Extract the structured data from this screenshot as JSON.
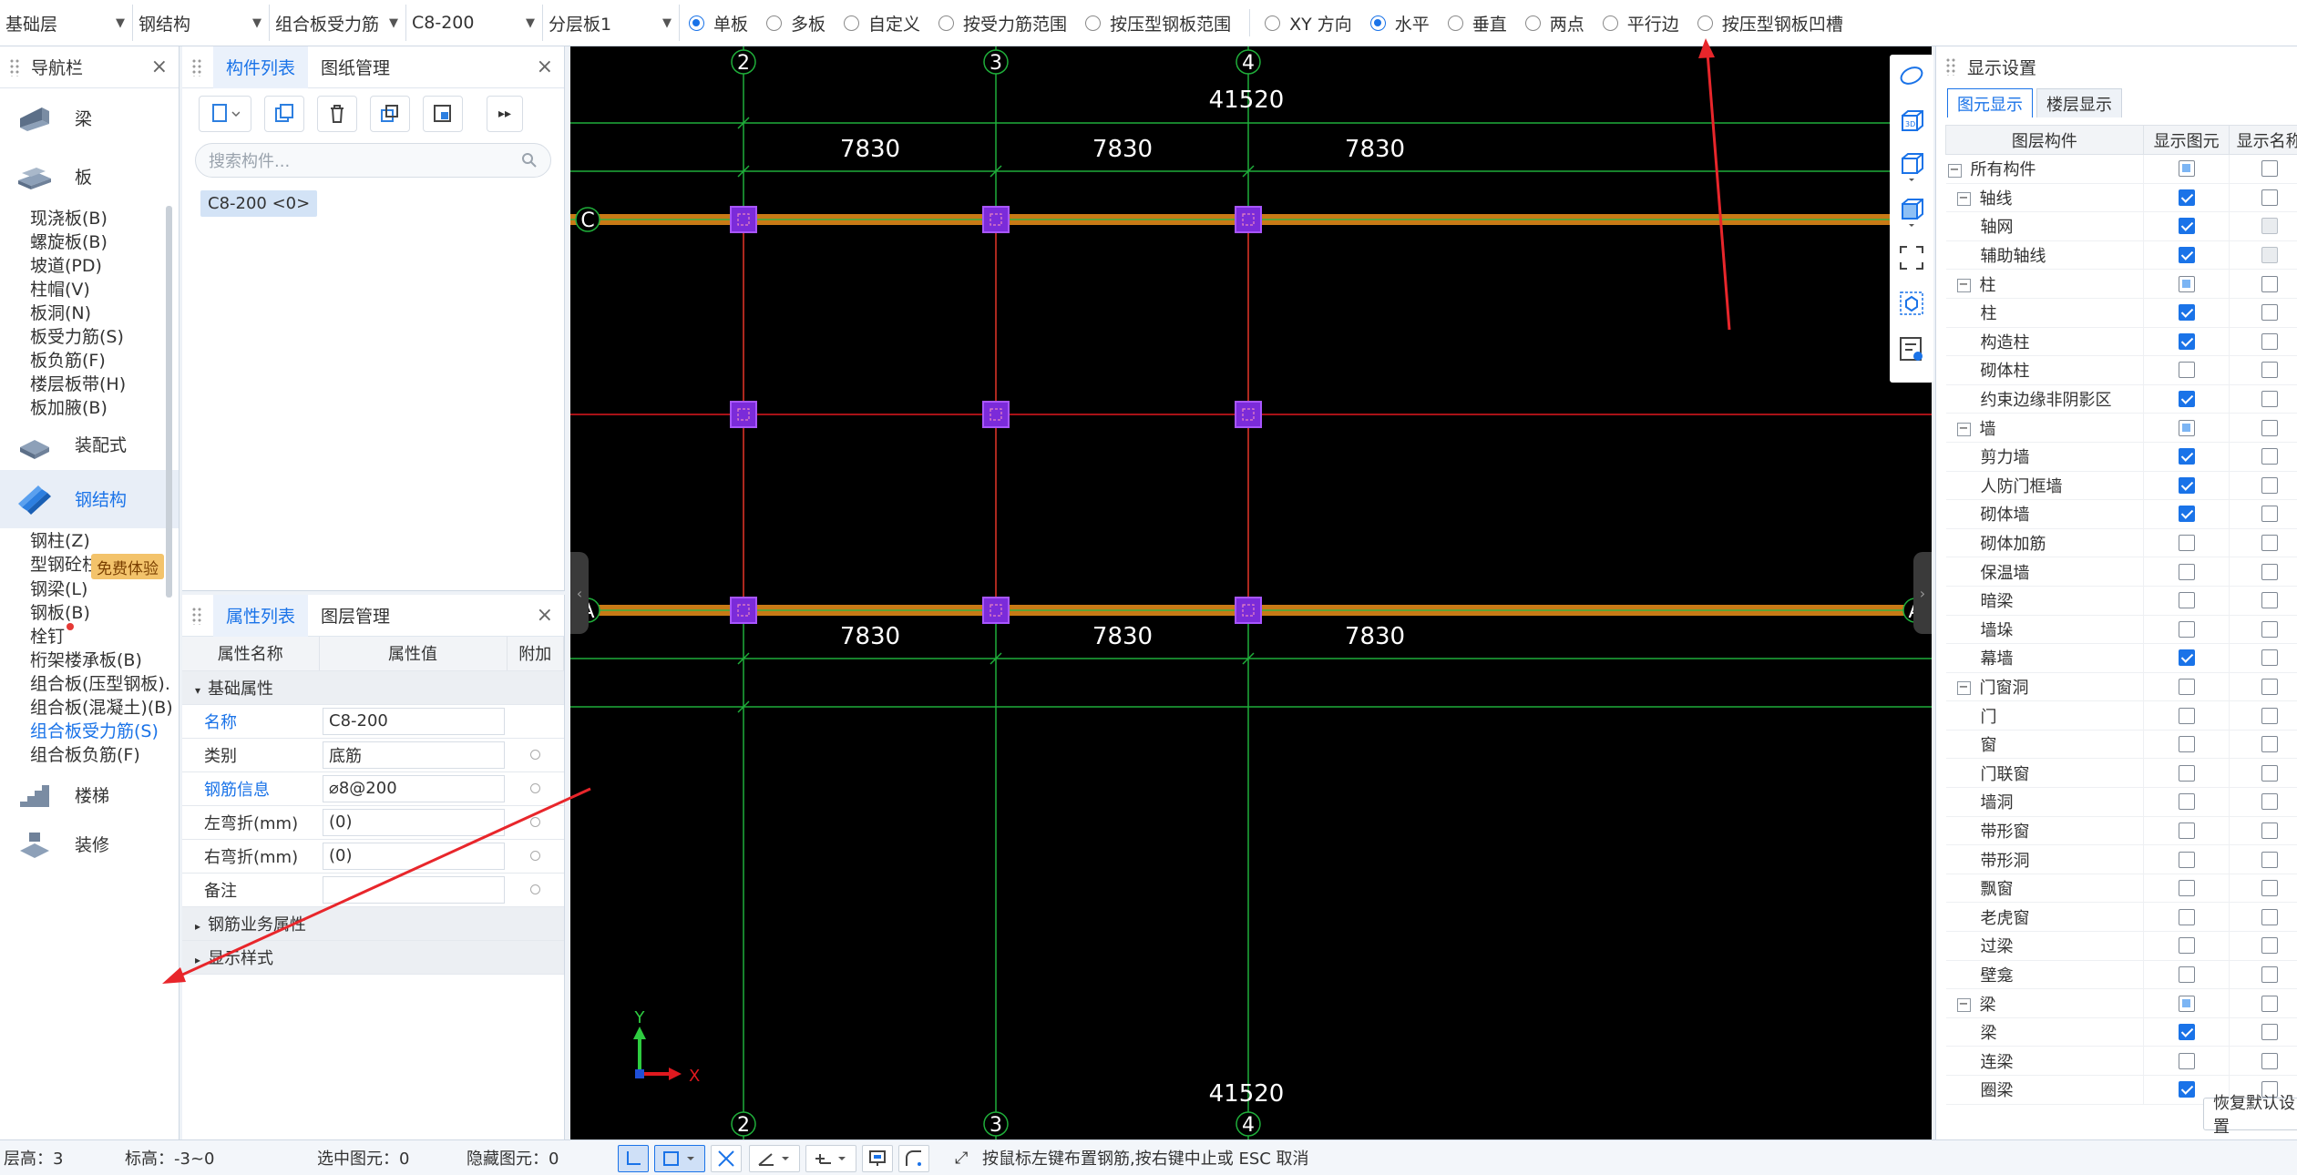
{
  "toolbar": {
    "selects": [
      "基础层",
      "钢结构",
      "组合板受力筋",
      "C8-200",
      "分层板1"
    ],
    "scope_options": [
      {
        "label": "单板",
        "checked": true
      },
      {
        "label": "多板",
        "checked": false
      },
      {
        "label": "自定义",
        "checked": false
      },
      {
        "label": "按受力筋范围",
        "checked": false
      },
      {
        "label": "按压型钢板范围",
        "checked": false
      }
    ],
    "direction_options": [
      {
        "label": "XY 方向",
        "checked": false
      },
      {
        "label": "水平",
        "checked": true
      },
      {
        "label": "垂直",
        "checked": false
      },
      {
        "label": "两点",
        "checked": false
      },
      {
        "label": "平行边",
        "checked": false
      },
      {
        "label": "按压型钢板凹槽",
        "checked": false
      }
    ]
  },
  "nav": {
    "title": "导航栏",
    "promo": "免费体验",
    "categories": {
      "beam": "梁",
      "slab": "板",
      "decoration": "装配式",
      "steel": "钢结构",
      "stairs": "楼梯",
      "finish": "装修"
    },
    "slab_items": [
      "现浇板(B)",
      "螺旋板(B)",
      "坡道(PD)",
      "柱帽(V)",
      "板洞(N)",
      "板受力筋(S)",
      "板负筋(F)",
      "楼层板带(H)",
      "板加腋(B)"
    ],
    "steel_items": [
      "钢柱(Z)",
      "型钢砼柱(Z)",
      "钢梁(L)",
      "钢板(B)",
      "栓钉",
      "桁架楼承板(B)",
      "组合板(压型钢板).",
      "组合板(混凝土)(B)",
      "组合板受力筋(S)",
      "组合板负筋(F)"
    ],
    "active_item": "组合板受力筋(S)"
  },
  "component_panel": {
    "tabs": [
      "构件列表",
      "图纸管理"
    ],
    "search_placeholder": "搜索构件...",
    "component": "C8-200 <0>"
  },
  "properties": {
    "tabs": [
      "属性列表",
      "图层管理"
    ],
    "headers": [
      "属性名称",
      "属性值",
      "附加"
    ],
    "group_basic": "基础属性",
    "rows": [
      {
        "name": "名称",
        "value": "C8-200"
      },
      {
        "name": "类别",
        "value": "底筋"
      },
      {
        "name": "钢筋信息",
        "value": "⌀8@200"
      },
      {
        "name": "左弯折(mm)",
        "value": "(0)"
      },
      {
        "name": "右弯折(mm)",
        "value": "(0)"
      },
      {
        "name": "备注",
        "value": ""
      }
    ],
    "group_business": "钢筋业务属性",
    "group_display": "显示样式"
  },
  "canvas": {
    "axis_labels_top": [
      "2",
      "3",
      "4"
    ],
    "axis_labels_bottom": [
      "2",
      "3",
      "4"
    ],
    "axis_labels_left": [
      "C",
      "A"
    ],
    "axis_labels_right": [
      "A"
    ],
    "dim_total": "41520",
    "dim_span": "7830",
    "axis_x_label": "X",
    "axis_y_label": "Y"
  },
  "display_settings": {
    "title": "显示设置",
    "tabs": [
      "图元显示",
      "楼层显示"
    ],
    "headers": [
      "图层构件",
      "显示图元",
      "显示名称"
    ],
    "rows": [
      {
        "label": "所有构件",
        "level": 0,
        "expander": "−",
        "show": "partial",
        "name": "off"
      },
      {
        "label": "轴线",
        "level": 1,
        "expander": "−",
        "show": "on",
        "name": "off"
      },
      {
        "label": "轴网",
        "level": 2,
        "show": "on",
        "name": "disabled"
      },
      {
        "label": "辅助轴线",
        "level": 2,
        "show": "on",
        "name": "disabled"
      },
      {
        "label": "柱",
        "level": 1,
        "expander": "−",
        "show": "partial",
        "name": "off"
      },
      {
        "label": "柱",
        "level": 2,
        "show": "on",
        "name": "off"
      },
      {
        "label": "构造柱",
        "level": 2,
        "show": "on",
        "name": "off"
      },
      {
        "label": "砌体柱",
        "level": 2,
        "show": "off",
        "name": "off"
      },
      {
        "label": "约束边缘非阴影区",
        "level": 2,
        "show": "on",
        "name": "off"
      },
      {
        "label": "墙",
        "level": 1,
        "expander": "−",
        "show": "partial",
        "name": "off"
      },
      {
        "label": "剪力墙",
        "level": 2,
        "show": "on",
        "name": "off"
      },
      {
        "label": "人防门框墙",
        "level": 2,
        "show": "on",
        "name": "off"
      },
      {
        "label": "砌体墙",
        "level": 2,
        "show": "on",
        "name": "off"
      },
      {
        "label": "砌体加筋",
        "level": 2,
        "show": "off",
        "name": "off"
      },
      {
        "label": "保温墙",
        "level": 2,
        "show": "off",
        "name": "off"
      },
      {
        "label": "暗梁",
        "level": 2,
        "show": "off",
        "name": "off"
      },
      {
        "label": "墙垛",
        "level": 2,
        "show": "off",
        "name": "off"
      },
      {
        "label": "幕墙",
        "level": 2,
        "show": "on",
        "name": "off"
      },
      {
        "label": "门窗洞",
        "level": 1,
        "expander": "−",
        "show": "off",
        "name": "off"
      },
      {
        "label": "门",
        "level": 2,
        "show": "off",
        "name": "off"
      },
      {
        "label": "窗",
        "level": 2,
        "show": "off",
        "name": "off"
      },
      {
        "label": "门联窗",
        "level": 2,
        "show": "off",
        "name": "off"
      },
      {
        "label": "墙洞",
        "level": 2,
        "show": "off",
        "name": "off"
      },
      {
        "label": "带形窗",
        "level": 2,
        "show": "off",
        "name": "off"
      },
      {
        "label": "带形洞",
        "level": 2,
        "show": "off",
        "name": "off"
      },
      {
        "label": "飘窗",
        "level": 2,
        "show": "off",
        "name": "off"
      },
      {
        "label": "老虎窗",
        "level": 2,
        "show": "off",
        "name": "off"
      },
      {
        "label": "过梁",
        "level": 2,
        "show": "off",
        "name": "off"
      },
      {
        "label": "壁龛",
        "level": 2,
        "show": "off",
        "name": "off"
      },
      {
        "label": "梁",
        "level": 1,
        "expander": "−",
        "show": "partial",
        "name": "off"
      },
      {
        "label": "梁",
        "level": 2,
        "show": "on",
        "name": "off"
      },
      {
        "label": "连梁",
        "level": 2,
        "show": "off",
        "name": "off"
      },
      {
        "label": "圈梁",
        "level": 2,
        "show": "on",
        "name": "off"
      }
    ],
    "restore_button": "恢复默认设置"
  },
  "status": {
    "floor_height": "层高：3",
    "elevation": "标高：-3~0",
    "selected": "选中图元：0",
    "hidden": "隐藏图元：0",
    "hint": "按鼠标左键布置钢筋,按右键中止或 ESC 取消"
  },
  "colors": {
    "accent": "#1a73e8",
    "canvas_bg": "#000000",
    "grid_green": "#1fae3a",
    "rebar_red": "#e0191f",
    "beam_orange": "#c87a16",
    "column_purple": "#8a2be2",
    "annotation_arrow": "#e8262b"
  }
}
